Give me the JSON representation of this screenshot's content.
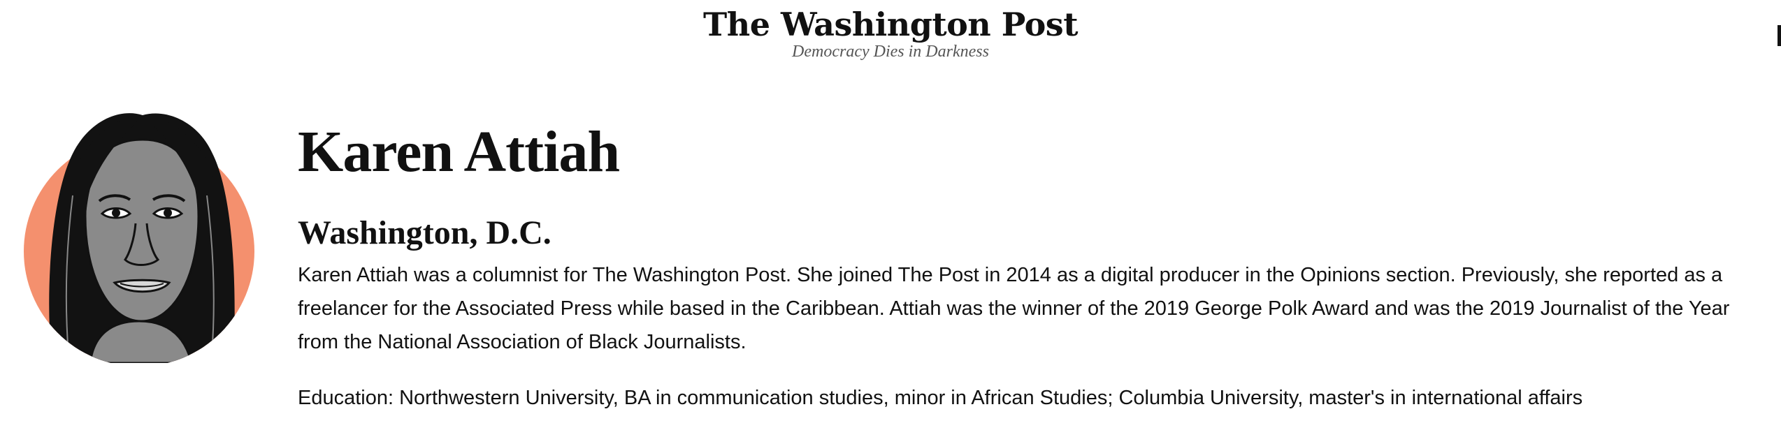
{
  "masthead": {
    "logo_text": "The Washington Post",
    "tagline": "Democracy Dies in Darkness"
  },
  "profile": {
    "name": "Karen Attiah",
    "location": "Washington, D.C.",
    "bio": "Karen Attiah was a columnist for The Washington Post. She joined The Post in 2014 as a digital producer in the Opinions section. Previously, she reported as a freelancer for the Associated Press while based in the Caribbean. Attiah was the winner of the 2019 George Polk Award and was the 2019 Journalist of the Year from the National Association of Black Journalists.",
    "education": "Education: Northwestern University, BA in communication studies, minor in African Studies; Columbia University, master's in international affairs"
  },
  "colors": {
    "avatar_circle": "#f4906e",
    "skin": "#8a8a8a",
    "hair": "#121212",
    "text": "#111111",
    "tagline": "#555555"
  }
}
